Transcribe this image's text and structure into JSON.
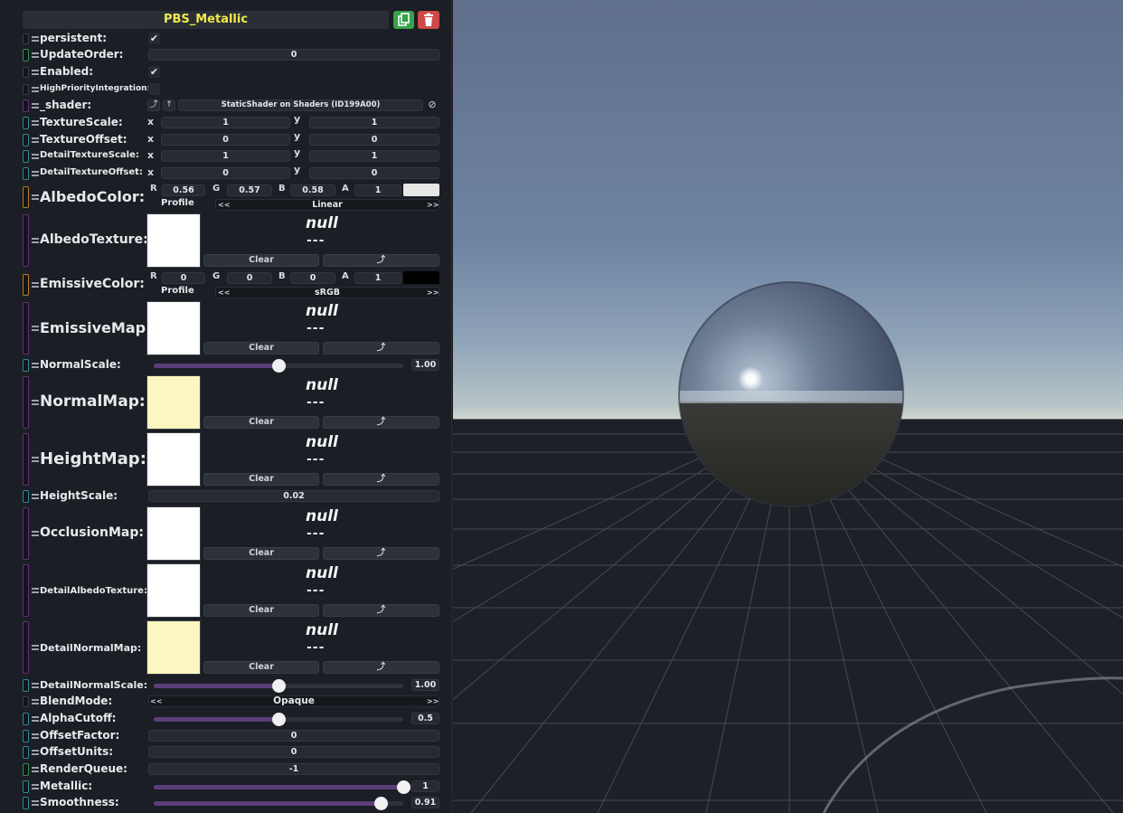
{
  "component_title": "PBS_Metallic",
  "colors": {
    "title": "#f2e94e",
    "duplicate": "#36a24a",
    "delete": "#d04848",
    "slider_fill": "#5c3d7a"
  },
  "fields": {
    "persistent": {
      "label": "persistent:",
      "checked": "✔"
    },
    "update_order": {
      "label": "UpdateOrder:",
      "value": "0"
    },
    "enabled": {
      "label": "Enabled:",
      "checked": "✔"
    },
    "high_priority": {
      "label": "HighPriorityIntegration:"
    },
    "shader": {
      "label": "_shader:",
      "value": "StaticShader on Shaders (ID199A00)",
      "icon_left": "⤴",
      "icon_up": "↑",
      "icon_clear": "⊘"
    },
    "texture_scale": {
      "label": "TextureScale:",
      "x": "1",
      "y": "1"
    },
    "texture_offset": {
      "label": "TextureOffset:",
      "x": "0",
      "y": "0"
    },
    "detail_texture_scale": {
      "label": "DetailTextureScale:",
      "x": "1",
      "y": "1"
    },
    "detail_texture_offset": {
      "label": "DetailTextureOffset:",
      "x": "0",
      "y": "0"
    },
    "albedo_color": {
      "label": "AlbedoColor:",
      "r": "0.56",
      "g": "0.57",
      "b": "0.58",
      "a": "1",
      "profile_label": "Profile",
      "profile": "Linear",
      "swatch": "#e6e6e6"
    },
    "albedo_texture": {
      "label": "AlbedoTexture:"
    },
    "emissive_color": {
      "label": "EmissiveColor:",
      "r": "0",
      "g": "0",
      "b": "0",
      "a": "1",
      "profile_label": "Profile",
      "profile": "sRGB",
      "swatch": "#000000"
    },
    "emissive_map": {
      "label": "EmissiveMap:"
    },
    "normal_scale": {
      "label": "NormalScale:",
      "value": "1.00",
      "fraction": 0.5
    },
    "normal_map": {
      "label": "NormalMap:"
    },
    "height_map": {
      "label": "HeightMap:"
    },
    "height_scale": {
      "label": "HeightScale:",
      "value": "0.02"
    },
    "occlusion_map": {
      "label": "OcclusionMap:"
    },
    "detail_albedo_texture": {
      "label": "DetailAlbedoTexture:"
    },
    "detail_normal_map": {
      "label": "DetailNormalMap:"
    },
    "detail_normal_scale": {
      "label": "DetailNormalScale:",
      "value": "1.00",
      "fraction": 0.5
    },
    "blend_mode": {
      "label": "BlendMode:",
      "value": "Opaque"
    },
    "alpha_cutoff": {
      "label": "AlphaCutoff:",
      "value": "0.5",
      "fraction": 0.5
    },
    "offset_factor": {
      "label": "OffsetFactor:",
      "value": "0"
    },
    "offset_units": {
      "label": "OffsetUnits:",
      "value": "0"
    },
    "render_queue": {
      "label": "RenderQueue:",
      "value": "-1"
    },
    "metallic": {
      "label": "Metallic:",
      "value": "1",
      "fraction": 1.0
    },
    "smoothness": {
      "label": "Smoothness:",
      "value": "0.91",
      "fraction": 0.91
    }
  },
  "texture_slot": {
    "null_text": "null",
    "dash_text": "---",
    "clear_label": "Clear",
    "pick_icon": "⤴"
  },
  "axis": {
    "x": "x",
    "y": "y",
    "r": "R",
    "g": "G",
    "b": "B",
    "a": "A"
  },
  "arrows": {
    "left": "<<",
    "right": ">>"
  }
}
